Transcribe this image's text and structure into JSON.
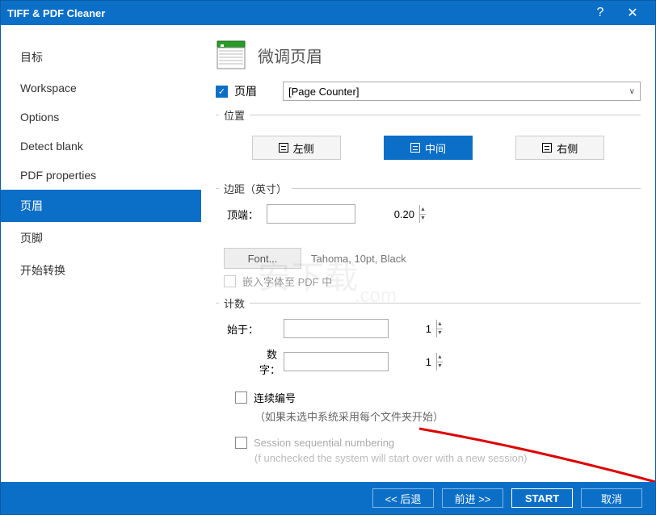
{
  "window": {
    "title": "TIFF & PDF Cleaner"
  },
  "sidebar": {
    "items": [
      {
        "label": "目标"
      },
      {
        "label": "Workspace"
      },
      {
        "label": "Options"
      },
      {
        "label": "Detect blank"
      },
      {
        "label": "PDF properties"
      },
      {
        "label": "页眉"
      },
      {
        "label": "页脚"
      },
      {
        "label": "开始转换"
      }
    ],
    "active_index": 5
  },
  "header": {
    "title": "微调页眉"
  },
  "enable": {
    "label": "页眉",
    "checked": true
  },
  "content_dropdown": {
    "selected": "[Page Counter]"
  },
  "position": {
    "legend": "位置",
    "left": "左侧",
    "center": "中间",
    "right": "右侧",
    "active": "center"
  },
  "margins": {
    "legend": "边距（英寸）",
    "top_label": "顶端：",
    "top_value": "0.20"
  },
  "font": {
    "button": "Font...",
    "info": "Tahoma, 10pt, Black",
    "embed_label": "嵌入字体至 PDF 中"
  },
  "count": {
    "legend": "计数",
    "start_label": "始于：",
    "start_value": "1",
    "digits_label": "数字：",
    "digits_value": "1"
  },
  "sequential": {
    "label1": "连续编号",
    "hint1": "（如果未选中系统采用每个文件夹开始）",
    "label2": "Session sequential numbering",
    "hint2": "(f unchecked the system will start over with a new session)"
  },
  "footer": {
    "back": "<< 后退",
    "forward": "前进 >>",
    "start": "START",
    "cancel": "取消"
  }
}
